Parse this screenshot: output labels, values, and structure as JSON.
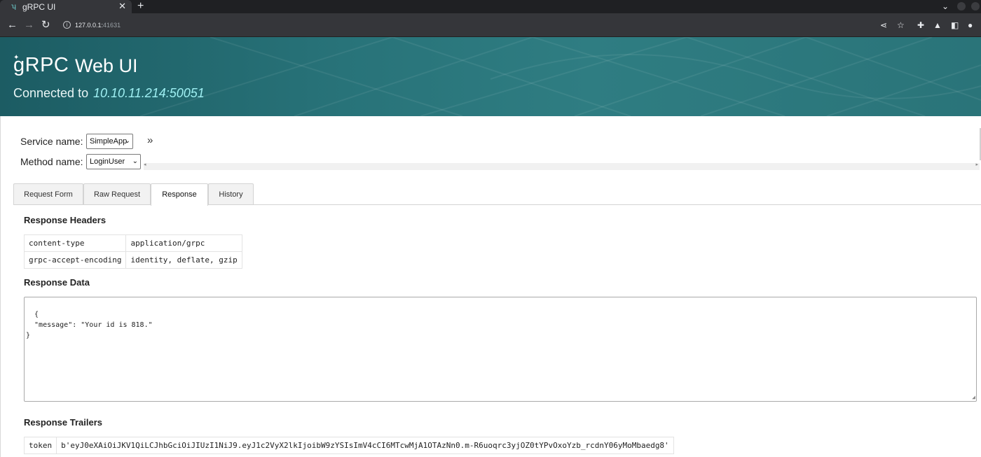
{
  "browser": {
    "tab_title": "gRPC UI",
    "tab_icon": "grpc-favicon",
    "new_tab_label": "+",
    "address_host": "127.0.0.1:",
    "address_port": "41631"
  },
  "header": {
    "logo": "gRPC",
    "title": "Web UI",
    "connected_label": "Connected to",
    "connected_address": "10.10.11.214:50051"
  },
  "form": {
    "service_label": "Service name:",
    "service_value": "SimpleApp",
    "method_label": "Method name:",
    "method_value": "LoginUser",
    "expand_glyph": "»"
  },
  "tabs": [
    "Request Form",
    "Raw Request",
    "Response",
    "History"
  ],
  "active_tab": "Response",
  "response": {
    "headers_title": "Response Headers",
    "headers": [
      {
        "key": "content-type",
        "value": "application/grpc"
      },
      {
        "key": "grpc-accept-encoding",
        "value": "identity, deflate, gzip"
      }
    ],
    "data_title": "Response Data",
    "data_text": "{\n  \"message\": \"Your id is 818.\"\n}",
    "trailers_title": "Response Trailers",
    "trailers": [
      {
        "key": "token",
        "value": "b'eyJ0eXAiOiJKV1QiLCJhbGciOiJIUzI1NiJ9.eyJ1c2VyX2lkIjoibW9zYSIsImV4cCI6MTcwMjA1OTAzNn0.m-R6uoqrc3yjOZ0tYPvOxoYzb_rcdnY06yMoMbaedg8'"
      }
    ]
  },
  "colors": {
    "banner_dark": "#1c5c63",
    "banner_light": "#2f7d82",
    "connected_address": "#9ff0f3"
  }
}
